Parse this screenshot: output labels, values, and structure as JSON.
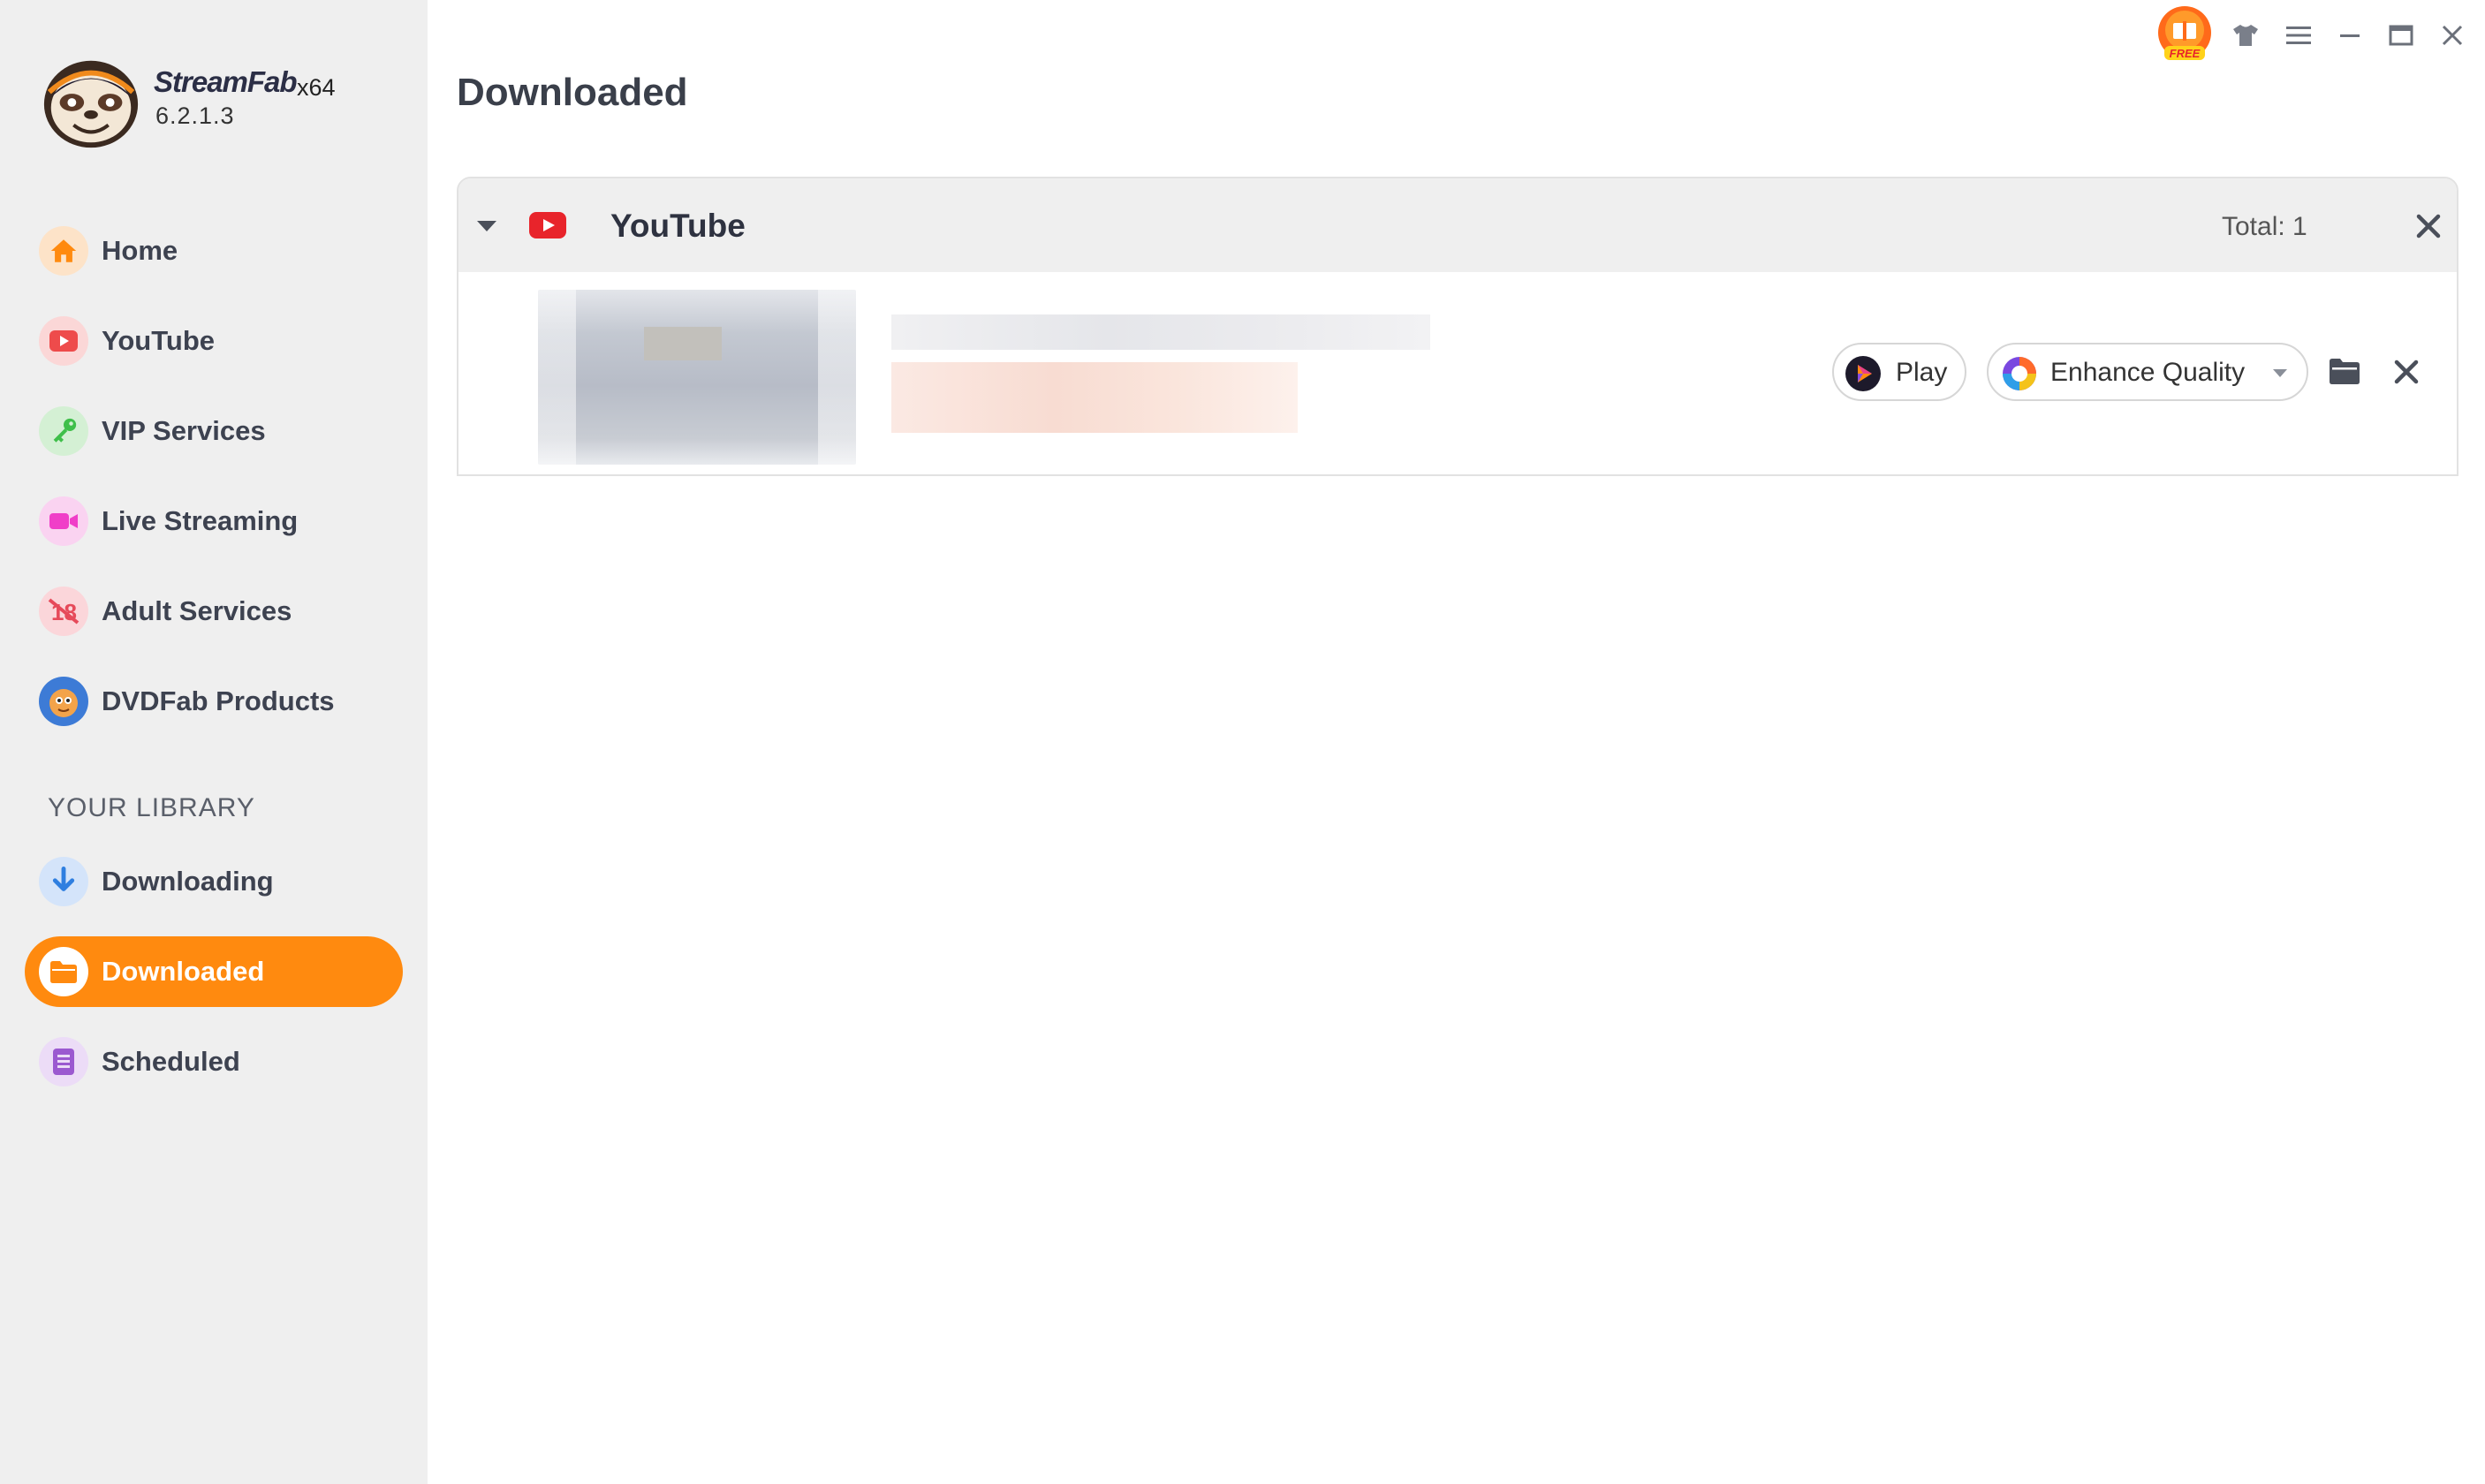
{
  "app": {
    "name": "StreamFab",
    "arch": "x64",
    "version": "6.2.1.3"
  },
  "sidebar": {
    "items": [
      {
        "label": "Home",
        "icon": "home-icon",
        "color": "#ff8a0f"
      },
      {
        "label": "YouTube",
        "icon": "youtube-icon",
        "color": "#ee4b4b"
      },
      {
        "label": "VIP Services",
        "icon": "key-icon",
        "color": "#3fbf4a"
      },
      {
        "label": "Live Streaming",
        "icon": "video-camera-icon",
        "color": "#f03ec8"
      },
      {
        "label": "Adult Services",
        "icon": "adult-18-icon",
        "color": "#e64a5a"
      },
      {
        "label": "DVDFab Products",
        "icon": "dvdfab-icon",
        "color": "#3d7bd6"
      }
    ],
    "library_label": "YOUR LIBRARY",
    "library_items": [
      {
        "label": "Downloading",
        "icon": "download-arrow-icon",
        "color": "#2f7fe0"
      },
      {
        "label": "Downloaded",
        "icon": "folder-icon",
        "color": "#ff8a0f",
        "active": true
      },
      {
        "label": "Scheduled",
        "icon": "schedule-list-icon",
        "color": "#9b59d0"
      }
    ]
  },
  "titlebar": {
    "free_badge": "FREE",
    "icons": [
      "gift-free-icon",
      "skin-shirt-icon",
      "menu-icon",
      "minimize-icon",
      "maximize-icon",
      "close-icon"
    ]
  },
  "main": {
    "title": "Downloaded",
    "groups": [
      {
        "service": "YouTube",
        "total_label": "Total: 1",
        "items": [
          {
            "play_label": "Play",
            "enhance_label": "Enhance Quality"
          }
        ]
      }
    ]
  },
  "colors": {
    "accent": "#ff8a0f",
    "sidebar_bg": "#efefef",
    "youtube_red": "#e8242b"
  }
}
